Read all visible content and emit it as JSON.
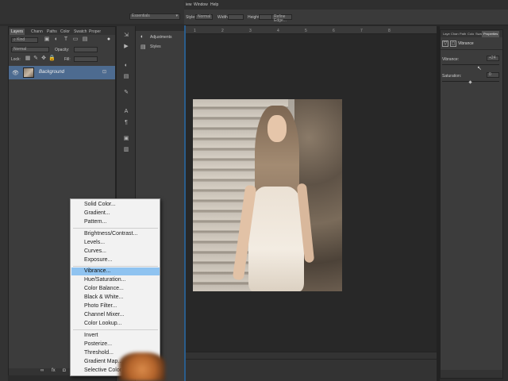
{
  "top_bar": {
    "dropdown": "Essentials",
    "menus": [
      "iew",
      "Window",
      "Help"
    ],
    "style_label": "Style:",
    "style_value": "Normal",
    "width_label": "Width:",
    "height_label": "Height:",
    "refine_button": "Refine Edge..."
  },
  "layers_panel": {
    "tabs": [
      "Layers",
      "Chann",
      "Paths",
      "Color",
      "Swatch",
      "Proper"
    ],
    "kind": "Kind",
    "blend_mode": "Normal",
    "opacity_label": "Opacity:",
    "lock_label": "Lock:",
    "fill_label": "Fill:",
    "layer_name": "Background"
  },
  "side_panel": {
    "items": [
      "Adjustments",
      "Styles"
    ]
  },
  "ruler_ticks": [
    "1",
    "2",
    "3",
    "4",
    "5",
    "6",
    "7",
    "8"
  ],
  "properties_panel": {
    "tabs": [
      "Laye",
      "Chan",
      "Path",
      "Colo",
      "Swat",
      "Properties"
    ],
    "title": "Vibrance",
    "vibrance_label": "Vibrance:",
    "vibrance_value": "+24",
    "saturation_label": "Saturation:",
    "saturation_value": "0"
  },
  "context_menu": {
    "items": [
      "Solid Color...",
      "Gradient...",
      "Pattern...",
      "Brightness/Contrast...",
      "Levels...",
      "Curves...",
      "Exposure...",
      "Vibrance...",
      "Hue/Saturation...",
      "Color Balance...",
      "Black & White...",
      "Photo Filter...",
      "Channel Mixer...",
      "Color Lookup...",
      "Invert",
      "Posterize...",
      "Threshold...",
      "Gradient Map...",
      "Selective Color..."
    ],
    "highlighted_index": 7
  },
  "colors": {
    "panel": "#3c3c3c",
    "canvas": "#2b2b2b",
    "selection": "#8fc3f0",
    "layer_row": "#4d6b90"
  }
}
